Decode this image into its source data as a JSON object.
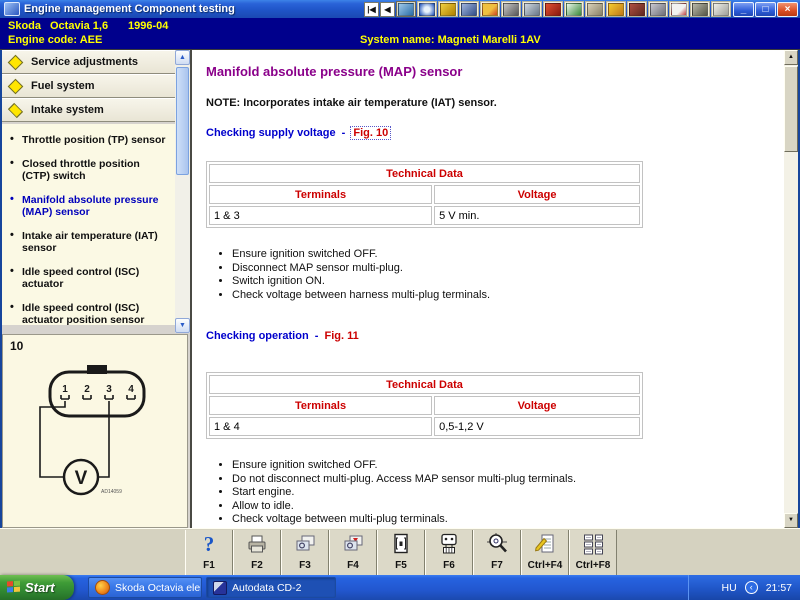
{
  "window": {
    "title": "Engine management Component testing",
    "nav_first": "|◀",
    "nav_back": "◀",
    "controls": {
      "minimize": "_",
      "restore": "□",
      "close": "×"
    },
    "toolbar_icons": [
      "car-wash-icon",
      "timer-icon",
      "tow-truck-icon",
      "mechanic-icon",
      "truck-icon",
      "dashboard-icon",
      "diagnostic-tool-icon",
      "engine-part-icon",
      "press-machine-icon",
      "hands-icon",
      "helmet-icon",
      "tools-icon",
      "wheel-icon",
      "warning-icon",
      "motorcycle-icon",
      "document-icon"
    ]
  },
  "header": {
    "make": "Skoda",
    "model": "Octavia 1,6",
    "years": "1996-04",
    "engine_code": "Engine code: AEE",
    "system_name": "System name: Magneti Marelli 1AV"
  },
  "sidebar": {
    "sections": [
      {
        "label": "Service adjustments"
      },
      {
        "label": "Fuel system"
      },
      {
        "label": "Intake system"
      }
    ],
    "items": [
      {
        "label": "Throttle position (TP) sensor"
      },
      {
        "label": "Closed throttle position (CTP) switch"
      },
      {
        "label": "Manifold absolute pressure (MAP) sensor"
      },
      {
        "label": "Intake air temperature (IAT) sensor"
      },
      {
        "label": "Idle speed control (ISC) actuator"
      },
      {
        "label": "Idle speed control (ISC) actuator position sensor"
      }
    ]
  },
  "figure_panel": {
    "number": "10",
    "terminals": [
      "1",
      "2",
      "3",
      "4"
    ],
    "meter": "V",
    "ref": "AD14059"
  },
  "content": {
    "title": "Manifold absolute pressure (MAP) sensor",
    "note": "NOTE: Incorporates intake air temperature (IAT) sensor.",
    "sections": [
      {
        "heading": "Checking supply voltage",
        "sep": "-",
        "fig": "Fig. 10",
        "table": {
          "title": "Technical Data",
          "col1": "Terminals",
          "col2": "Voltage",
          "c1": "1 & 3",
          "c2": "5 V min."
        },
        "bullets": [
          "Ensure ignition switched OFF.",
          "Disconnect MAP sensor multi-plug.",
          "Switch ignition ON.",
          "Check voltage between harness multi-plug terminals."
        ]
      },
      {
        "heading": "Checking operation",
        "sep": "-",
        "fig": "Fig. 11",
        "table": {
          "title": "Technical Data",
          "col1": "Terminals",
          "col2": "Voltage",
          "c1": "1 & 4",
          "c2": "0,5-1,2 V"
        },
        "bullets": [
          "Ensure ignition switched OFF.",
          "Do not disconnect multi-plug. Access MAP sensor multi-plug terminals.",
          "Start engine.",
          "Allow to idle.",
          "Check voltage between multi-plug terminals."
        ]
      }
    ]
  },
  "fkeys": [
    {
      "key": "F1",
      "icon": "help-icon"
    },
    {
      "key": "F2",
      "icon": "print-icon"
    },
    {
      "key": "F3",
      "icon": "previous-figure-icon"
    },
    {
      "key": "F4",
      "icon": "next-figure-icon"
    },
    {
      "key": "F5",
      "icon": "component-icon"
    },
    {
      "key": "F6",
      "icon": "connector-icon"
    },
    {
      "key": "F7",
      "icon": "locate-icon"
    },
    {
      "key": "Ctrl+F4",
      "icon": "edit-note-icon"
    },
    {
      "key": "Ctrl+F8",
      "icon": "data-list-icon"
    }
  ],
  "taskbar": {
    "start": "Start",
    "tasks": [
      {
        "label": "Skoda Octavia elektr..."
      },
      {
        "label": "Autodata CD-2"
      }
    ],
    "lang": "HU",
    "time": "21:57"
  }
}
